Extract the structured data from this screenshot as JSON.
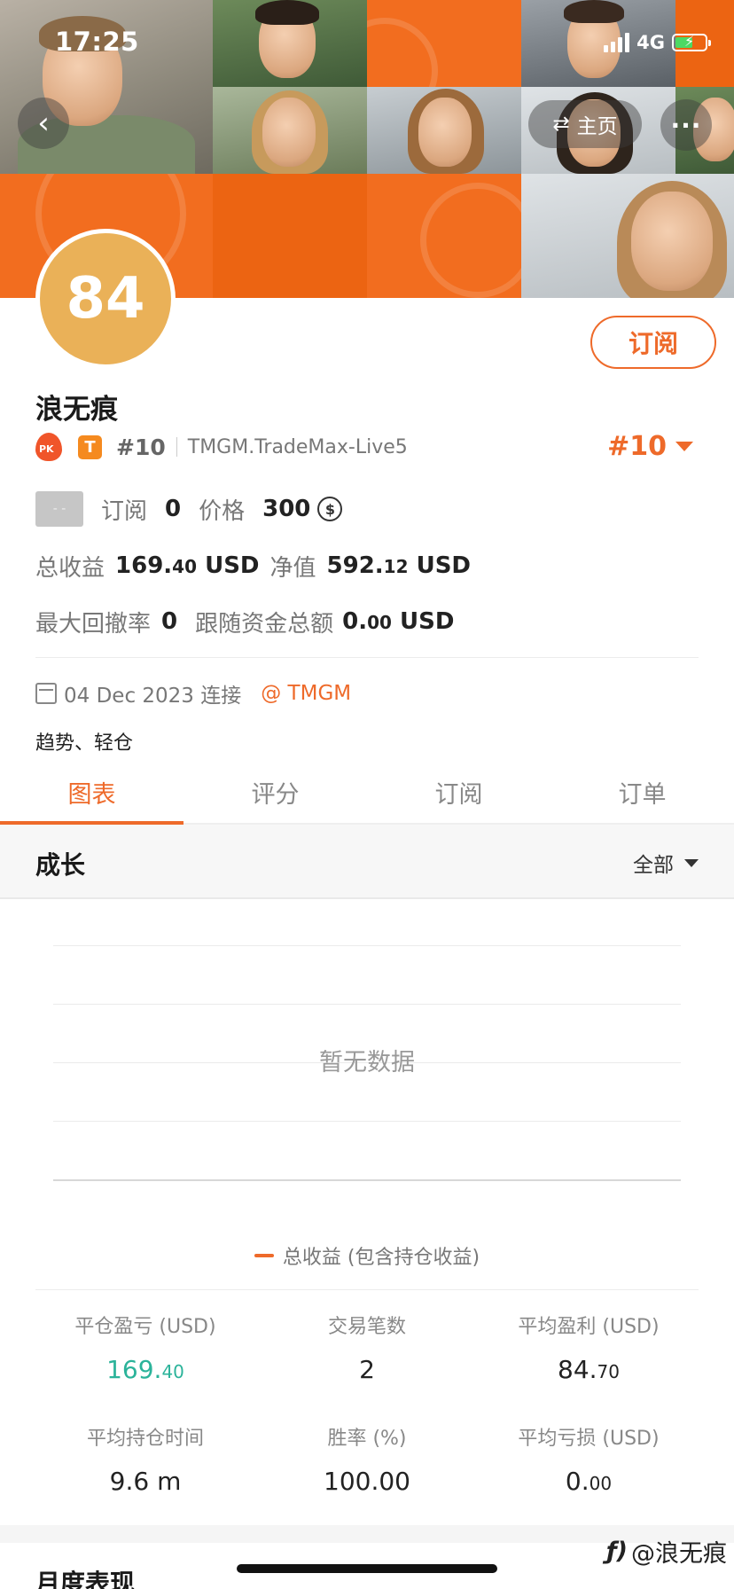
{
  "status_bar": {
    "time": "17:25",
    "network": "4G"
  },
  "nav": {
    "home_label": "主页"
  },
  "profile": {
    "avatar_text": "84",
    "subscribe_label": "订阅",
    "name": "浪无痕",
    "badge_t": "T",
    "rank_inline": "#10",
    "server": "TMGM.TradeMax-Live5",
    "rank_right": "#10",
    "gray_box_text": "- -",
    "subscriptions_label": "订阅",
    "subscriptions_value": "0",
    "price_label": "价格",
    "price_value": "300",
    "coin_symbol": "$",
    "total_profit_label": "总收益",
    "total_profit_int": "169.",
    "total_profit_dec": "40",
    "total_profit_unit": "USD",
    "net_value_label": "净值",
    "net_value_int": "592.",
    "net_value_dec": "12",
    "net_value_unit": "USD",
    "max_drawdown_label": "最大回撤率",
    "max_drawdown_value": "0",
    "follow_funds_label": "跟随资金总额",
    "follow_funds_int": "0.",
    "follow_funds_dec": "00",
    "follow_funds_unit": "USD",
    "connect_date": "04 Dec 2023 连接",
    "broker": "@ TMGM",
    "tags": "趋势、轻仓"
  },
  "tabs": [
    {
      "label": "图表",
      "active": true
    },
    {
      "label": "评分",
      "active": false
    },
    {
      "label": "订阅",
      "active": false
    },
    {
      "label": "订单",
      "active": false
    }
  ],
  "growth": {
    "title": "成长",
    "filter_label": "全部",
    "no_data": "暂无数据",
    "legend": "总收益 (包含持仓收益)"
  },
  "stats": [
    {
      "label": "平仓盈亏 (USD)",
      "value_int": "169.",
      "value_dec": "40",
      "green": true
    },
    {
      "label": "交易笔数",
      "value_int": "2",
      "value_dec": "",
      "green": false
    },
    {
      "label": "平均盈利 (USD)",
      "value_int": "84.",
      "value_dec": "70",
      "green": false
    },
    {
      "label": "平均持仓时间",
      "value_int": "9.6 m",
      "value_dec": "",
      "green": false
    },
    {
      "label": "胜率 (%)",
      "value_int": "100.00",
      "value_dec": "",
      "green": false
    },
    {
      "label": "平均亏损 (USD)",
      "value_int": "0.",
      "value_dec": "00",
      "green": false
    }
  ],
  "monthly_title": "月度表现",
  "watermark": "@浪无痕",
  "colors": {
    "accent": "#ee6a2a",
    "green": "#2bb39a",
    "avatar_bg": "#eab158"
  },
  "icons": [
    "back-arrow-icon",
    "swap-icon",
    "more-icon",
    "pk-flame-icon",
    "t-badge-icon",
    "caret-down-icon",
    "coin-icon",
    "calendar-icon"
  ]
}
